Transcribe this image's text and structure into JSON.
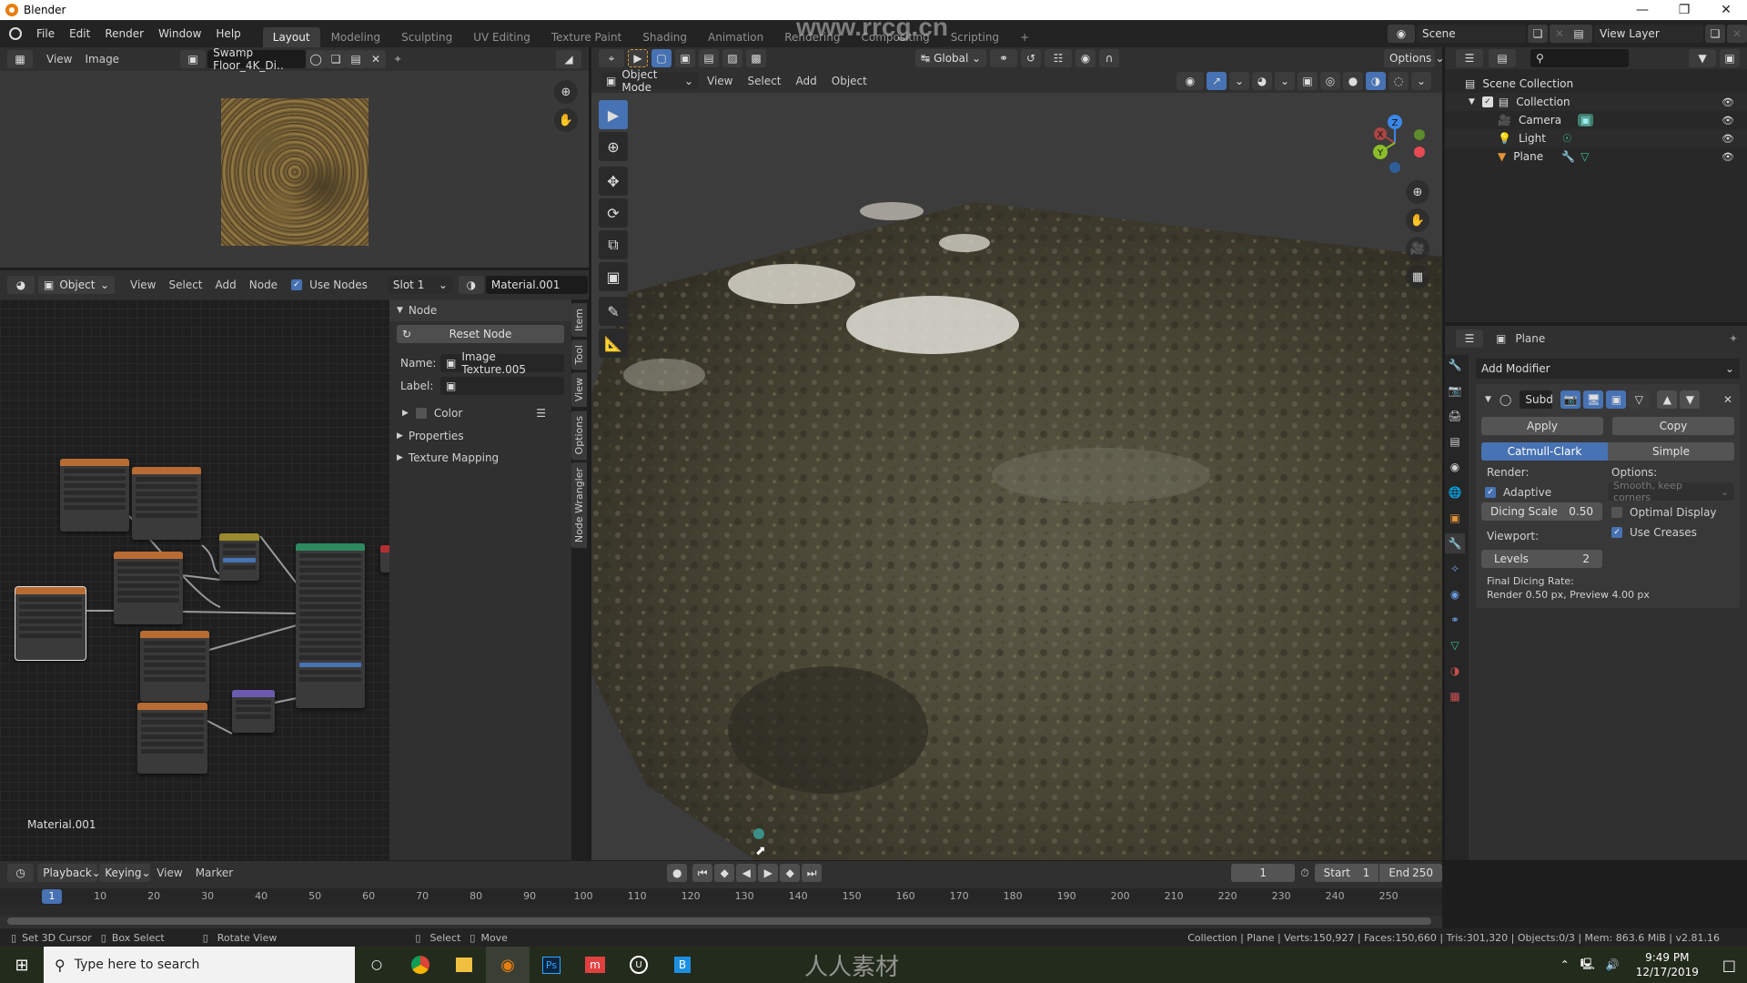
{
  "window": {
    "title": "Blender",
    "controls": [
      "minimize",
      "maximize",
      "close"
    ]
  },
  "menubar": {
    "menus": [
      "File",
      "Edit",
      "Render",
      "Window",
      "Help"
    ],
    "workspaces": [
      "Layout",
      "Modeling",
      "Sculpting",
      "UV Editing",
      "Texture Paint",
      "Shading",
      "Animation",
      "Rendering",
      "Compositing",
      "Scripting"
    ],
    "active_workspace": "Layout",
    "add_workspace": "+",
    "scene": "Scene",
    "view_layer": "View Layer",
    "watermark": "www.rrcg.cn"
  },
  "image_editor": {
    "menus": [
      "View",
      "Image"
    ],
    "image_name": "Swamp Floor_4K_Di.."
  },
  "node_editor": {
    "object_type": "Object",
    "menus": [
      "View",
      "Select",
      "Add",
      "Node"
    ],
    "use_nodes_label": "Use Nodes",
    "use_nodes": true,
    "slot": "Slot 1",
    "material": "Material.001",
    "material_label": "Material.001",
    "sidebar": {
      "panel_title": "Node",
      "reset_node": "Reset Node",
      "name_label": "Name:",
      "name_value": "Image Texture.005",
      "label_label": "Label:",
      "label_value": "",
      "color_label": "Color",
      "properties_label": "Properties",
      "texture_mapping_label": "Texture Mapping",
      "tabs": [
        "Item",
        "Tool",
        "View",
        "Options",
        "Node Wrangler"
      ]
    }
  },
  "viewport": {
    "transform_orientation": "Global",
    "options_label": "Options",
    "mode": "Object Mode",
    "menus": [
      "View",
      "Select",
      "Add",
      "Object"
    ],
    "gizmo_axes": [
      "X",
      "Y",
      "Z"
    ]
  },
  "outliner": {
    "root": "Scene Collection",
    "collection": "Collection",
    "items": [
      {
        "name": "Camera",
        "icon": "camera-icon"
      },
      {
        "name": "Light",
        "icon": "light-icon"
      },
      {
        "name": "Plane",
        "icon": "mesh-icon"
      }
    ]
  },
  "properties": {
    "object_name": "Plane",
    "add_modifier": "Add Modifier",
    "modifier_name": "Subd",
    "apply": "Apply",
    "copy": "Copy",
    "catmull_clark": "Catmull-Clark",
    "simple": "Simple",
    "render_label": "Render:",
    "options_label": "Options:",
    "adaptive_label": "Adaptive",
    "adaptive": true,
    "uv_smooth": "Smooth, keep corners",
    "dicing_scale_label": "Dicing Scale",
    "dicing_scale": "0.50",
    "optimal_display_label": "Optimal Display",
    "optimal_display": false,
    "use_creases_label": "Use Creases",
    "use_creases": true,
    "viewport_label": "Viewport:",
    "levels_label": "Levels",
    "levels": "2",
    "final_dicing_label": "Final Dicing Rate:",
    "final_dicing_value": "Render 0.50 px, Preview 4.00 px"
  },
  "timeline": {
    "menus": [
      "Playback",
      "Keying",
      "View",
      "Marker"
    ],
    "current_frame": "1",
    "start_label": "Start",
    "start": "1",
    "end_label": "End",
    "end": "250",
    "ticks": [
      "10",
      "20",
      "30",
      "40",
      "50",
      "60",
      "70",
      "80",
      "90",
      "100",
      "110",
      "120",
      "130",
      "140",
      "150",
      "160",
      "170",
      "180",
      "190",
      "200",
      "210",
      "220",
      "230",
      "240",
      "250"
    ]
  },
  "statusbar": {
    "hints": [
      "Set 3D Cursor",
      "Box Select",
      "Rotate View",
      "Select",
      "Move"
    ],
    "stats": "Collection | Plane | Verts:150,927 | Faces:150,660 | Tris:301,320 | Objects:0/3 | Mem: 863.6 MiB | v2.81.16"
  },
  "taskbar": {
    "search_placeholder": "Type here to search",
    "time": "9:49 PM",
    "date": "12/17/2019",
    "watermark": "人人素材"
  }
}
